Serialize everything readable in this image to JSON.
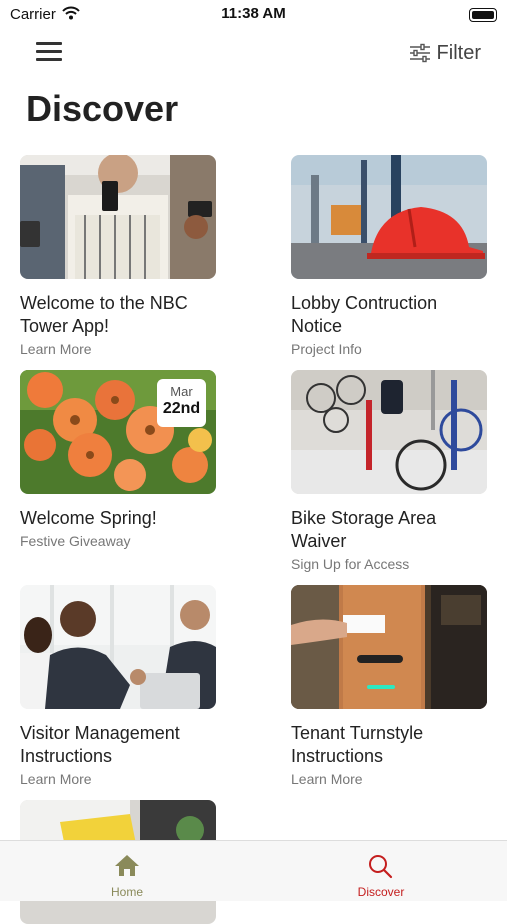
{
  "status_bar": {
    "carrier": "Carrier",
    "time": "11:38 AM"
  },
  "header": {
    "filter_label": "Filter",
    "title": "Discover"
  },
  "cards": [
    {
      "title": "Welcome to the NBC Tower App!",
      "subtitle": "Learn More"
    },
    {
      "title": "Lobby Contruction Notice",
      "subtitle": "Project Info"
    },
    {
      "title": "Welcome Spring!",
      "subtitle": "Festive Giveaway",
      "badge": {
        "month": "Mar",
        "day": "22nd"
      }
    },
    {
      "title": "Bike Storage Area Waiver",
      "subtitle": "Sign Up for Access"
    },
    {
      "title": "Visitor Management Instructions",
      "subtitle": "Learn More"
    },
    {
      "title": "Tenant Turnstyle Instructions",
      "subtitle": "Learn More"
    },
    {
      "title": "",
      "subtitle": ""
    }
  ],
  "tabbar": {
    "tabs": [
      {
        "label": "Home",
        "icon": "home-icon",
        "active": false
      },
      {
        "label": "Discover",
        "icon": "search-icon",
        "active": true
      }
    ],
    "active_color": "#c41e1e",
    "inactive_color": "#8a8a5a"
  }
}
